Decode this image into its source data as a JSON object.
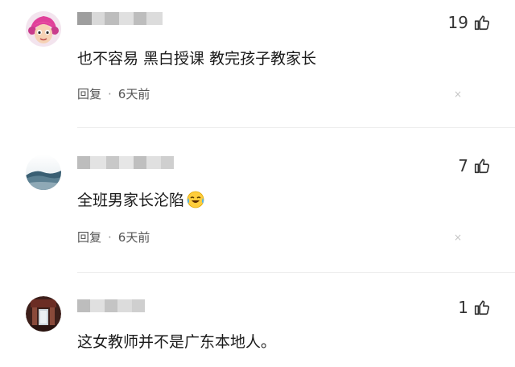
{
  "comments": [
    {
      "text": "也不容易 黑白授课 教完孩子教家长",
      "likes": "19",
      "reply_label": "回复",
      "separator": "·",
      "time": "6天前",
      "dismiss": "×"
    },
    {
      "text": "全班男家长沦陷",
      "likes": "7",
      "reply_label": "回复",
      "separator": "·",
      "time": "6天前",
      "dismiss": "×"
    },
    {
      "text": "这女教师并不是广东本地人。",
      "likes": "1"
    }
  ],
  "colors": {
    "blur_light": "#d9d9d9",
    "blur_mid": "#bdbdbd",
    "blur_dark": "#9e9e9e"
  },
  "icons": {
    "like": "thumbs-up-icon",
    "emoji": "laugh-cry-emoji-icon"
  }
}
